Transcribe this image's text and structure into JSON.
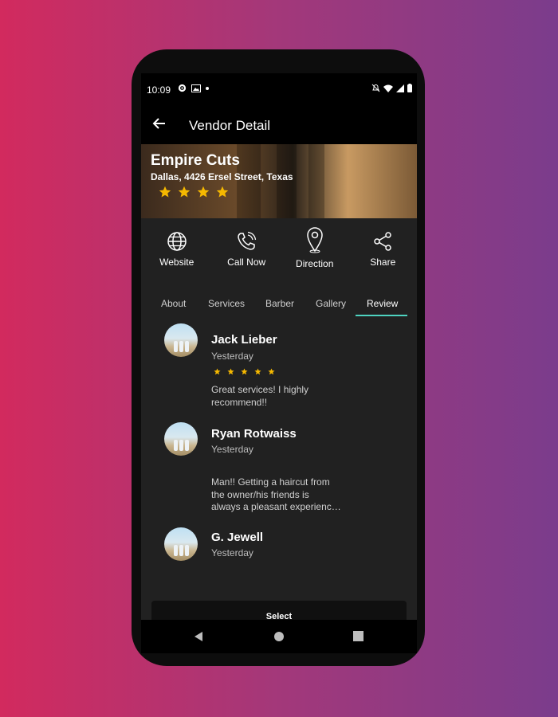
{
  "status_bar": {
    "time": "10:09"
  },
  "app_bar": {
    "title": "Vendor Detail"
  },
  "vendor": {
    "name": "Empire Cuts",
    "address": "Dallas, 4426  Ersel Street, Texas",
    "rating": 4
  },
  "actions": [
    {
      "label": "Website",
      "icon": "globe-icon"
    },
    {
      "label": "Call Now",
      "icon": "phone-icon"
    },
    {
      "label": "Direction",
      "icon": "map-pin-icon"
    },
    {
      "label": "Share",
      "icon": "share-icon"
    }
  ],
  "tabs": [
    "About",
    "Services",
    "Barber",
    "Gallery",
    "Review"
  ],
  "active_tab": "Review",
  "reviews": [
    {
      "name": "Jack Lieber",
      "date": "Yesterday",
      "stars": 5,
      "text_lines": [
        "Great services! I highly",
        "recommend!!"
      ]
    },
    {
      "name": "Ryan Rotwaiss",
      "date": "Yesterday",
      "stars": 0,
      "text_lines": [
        "Man!! Getting a haircut from",
        "the owner/his friends is",
        "always a pleasant experienc…"
      ]
    },
    {
      "name": "G. Jewell",
      "date": "Yesterday",
      "stars": 0,
      "text_lines": []
    }
  ],
  "select_button": "Select",
  "colors": {
    "accent": "#4ed3c0",
    "star": "#f5b800",
    "background": "#212121"
  }
}
